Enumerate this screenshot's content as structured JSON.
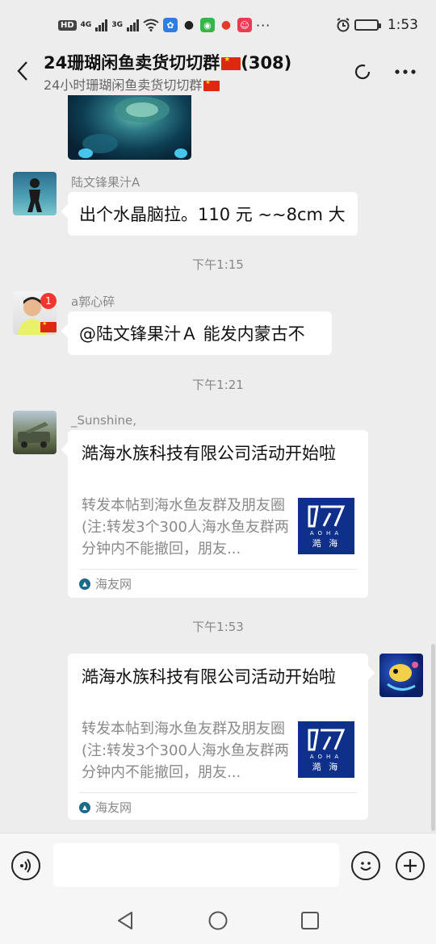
{
  "status_bar": {
    "chip": "HD",
    "net_1": "4G",
    "net_2": "3G",
    "dots": "···",
    "time": "1:53",
    "battery_level": 0.85
  },
  "header": {
    "title": "24珊瑚闲鱼卖货切切群",
    "member_count": "(308)",
    "subtitle": "24小时珊瑚闲鱼卖货切切群"
  },
  "messages": {
    "msg1": {
      "sender": "陆文锋果汁A",
      "text": "出个水晶脑拉。110 元 ~~8cm 大"
    },
    "time1": "下午1:15",
    "msg2": {
      "sender": "a郭心碎",
      "badge": "1",
      "text": "@陆文锋果汁Ａ 能发内蒙古不"
    },
    "time2": "下午1:21",
    "msg3": {
      "sender": "_Sunshine,",
      "title": "澔海水族科技有限公司活动开始啦",
      "desc": "转发本帖到海水鱼友群及朋友圈(注:转发3个300人海水鱼友群两分钟内不能撤回，朋友...",
      "source": "海友网",
      "thumb_text": "AOHA",
      "thumb_cn": "澔 海"
    },
    "time3": "下午1:53",
    "msg4": {
      "title": "澔海水族科技有限公司活动开始啦",
      "desc": "转发本帖到海水鱼友群及朋友圈(注:转发3个300人海水鱼友群两分钟内不能撤回，朋友...",
      "source": "海友网",
      "thumb_text": "AOHA",
      "thumb_cn": "澔 海"
    }
  },
  "input": {
    "value": ""
  }
}
